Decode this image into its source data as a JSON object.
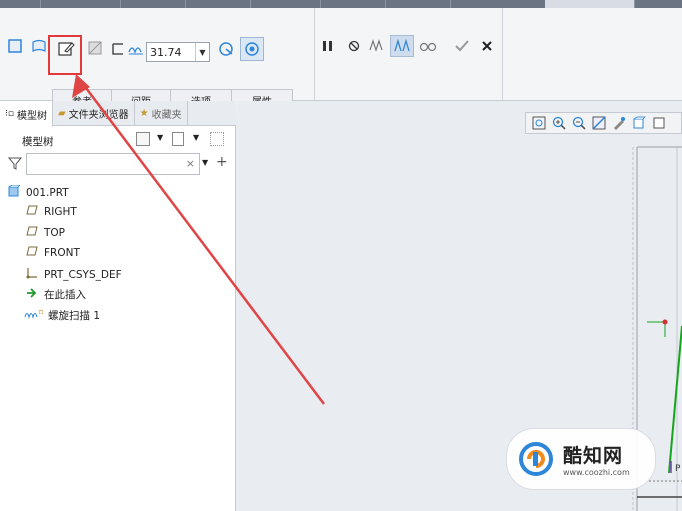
{
  "ribbon": {
    "depth_value": "31.74",
    "subtabs": [
      "参考",
      "间距",
      "选项",
      "属性"
    ]
  },
  "panel": {
    "tabs": [
      "模型树",
      "文件夹浏览器",
      "收藏夹"
    ],
    "tree_title": "模型树",
    "filter_placeholder": ""
  },
  "tree": {
    "items": [
      "001.PRT",
      "RIGHT",
      "TOP",
      "FRONT",
      "PRT_CSYS_DEF",
      "在此插入",
      "螺旋扫描 1"
    ]
  },
  "watermark": {
    "title": "酷知网",
    "url": "www.coozhi.com"
  },
  "colors": {
    "highlight": "#e23a3a",
    "arrow": "#e04545",
    "accent_blue": "#2e86d8",
    "datum_plane": "#7a6a3a"
  }
}
